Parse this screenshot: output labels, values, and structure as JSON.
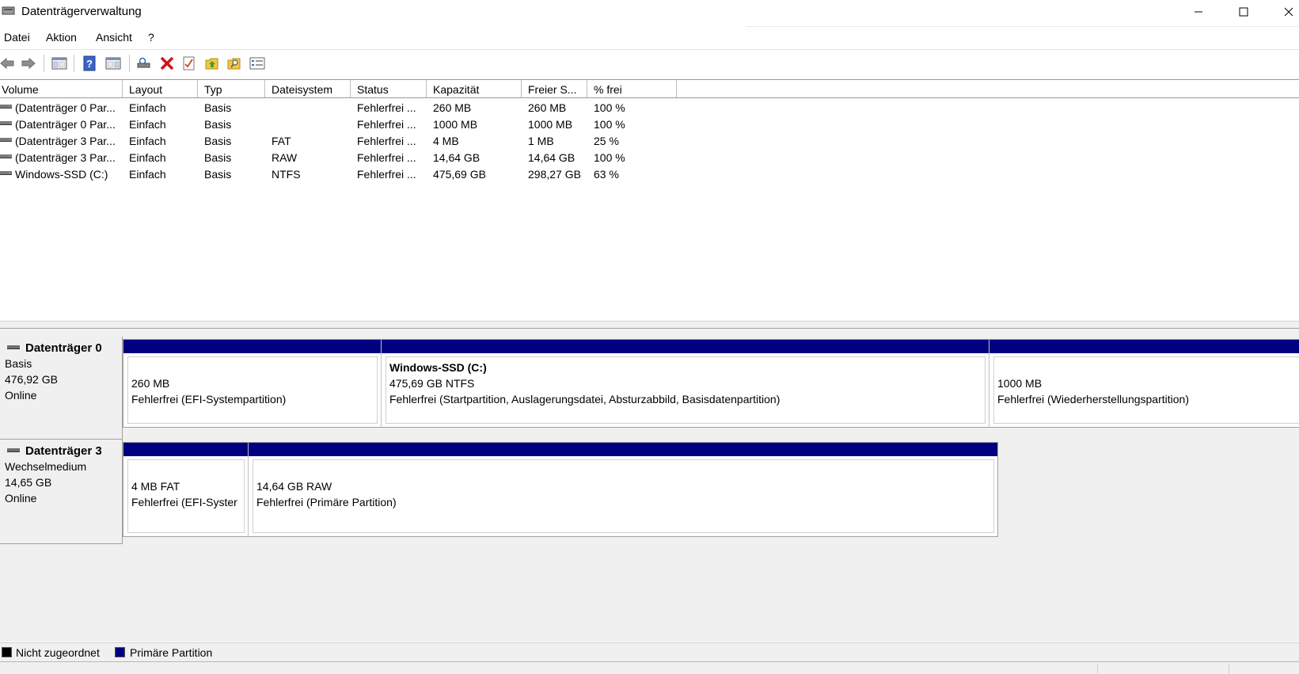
{
  "window": {
    "title": "Datenträgerverwaltung"
  },
  "menu": [
    "Datei",
    "Aktion",
    "Ansicht",
    "?"
  ],
  "toolbar": {
    "icons": [
      "back-arrow-icon",
      "forward-arrow-icon",
      "console-tree-icon",
      "help-icon",
      "details-pane-icon",
      "rescan-disks-icon",
      "delete-icon",
      "checklist-icon",
      "folder-up-icon",
      "folder-search-icon",
      "properties-icon"
    ]
  },
  "list": {
    "columns": [
      "Volume",
      "Layout",
      "Typ",
      "Dateisystem",
      "Status",
      "Kapazität",
      "Freier S...",
      "% frei"
    ],
    "rows": [
      [
        "(Datenträger 0 Par...",
        "Einfach",
        "Basis",
        "",
        "Fehlerfrei ...",
        "260 MB",
        "260 MB",
        "100 %"
      ],
      [
        "(Datenträger 0 Par...",
        "Einfach",
        "Basis",
        "",
        "Fehlerfrei ...",
        "1000 MB",
        "1000 MB",
        "100 %"
      ],
      [
        "(Datenträger 3 Par...",
        "Einfach",
        "Basis",
        "FAT",
        "Fehlerfrei ...",
        "4 MB",
        "1 MB",
        "25 %"
      ],
      [
        "(Datenträger 3 Par...",
        "Einfach",
        "Basis",
        "RAW",
        "Fehlerfrei ...",
        "14,64 GB",
        "14,64 GB",
        "100 %"
      ],
      [
        "Windows-SSD (C:)",
        "Einfach",
        "Basis",
        "NTFS",
        "Fehlerfrei ...",
        "475,69 GB",
        "298,27 GB",
        "63 %"
      ]
    ]
  },
  "disks": [
    {
      "name": "Datenträger 0",
      "type": "Basis",
      "size": "476,92 GB",
      "state": "Online",
      "partitions": [
        {
          "title": "",
          "line1": "260 MB",
          "line2": "Fehlerfrei (EFI-Systempartition)"
        },
        {
          "title": "Windows-SSD  (C:)",
          "line1": "475,69 GB NTFS",
          "line2": "Fehlerfrei (Startpartition, Auslagerungsdatei, Absturzabbild, Basisdatenpartition)"
        },
        {
          "title": "",
          "line1": "1000 MB",
          "line2": "Fehlerfrei (Wiederherstellungspartition)"
        }
      ]
    },
    {
      "name": "Datenträger 3",
      "type": "Wechselmedium",
      "size": "14,65 GB",
      "state": "Online",
      "partitions": [
        {
          "title": "",
          "line1": "4 MB FAT",
          "line2": "Fehlerfrei (EFI-Syster"
        },
        {
          "title": "",
          "line1": "14,64 GB RAW",
          "line2": "Fehlerfrei (Primäre Partition)"
        }
      ]
    }
  ],
  "legend": [
    {
      "label": "Nicht zugeordnet",
      "color": "#000000"
    },
    {
      "label": "Primäre Partition",
      "color": "#000080"
    }
  ]
}
